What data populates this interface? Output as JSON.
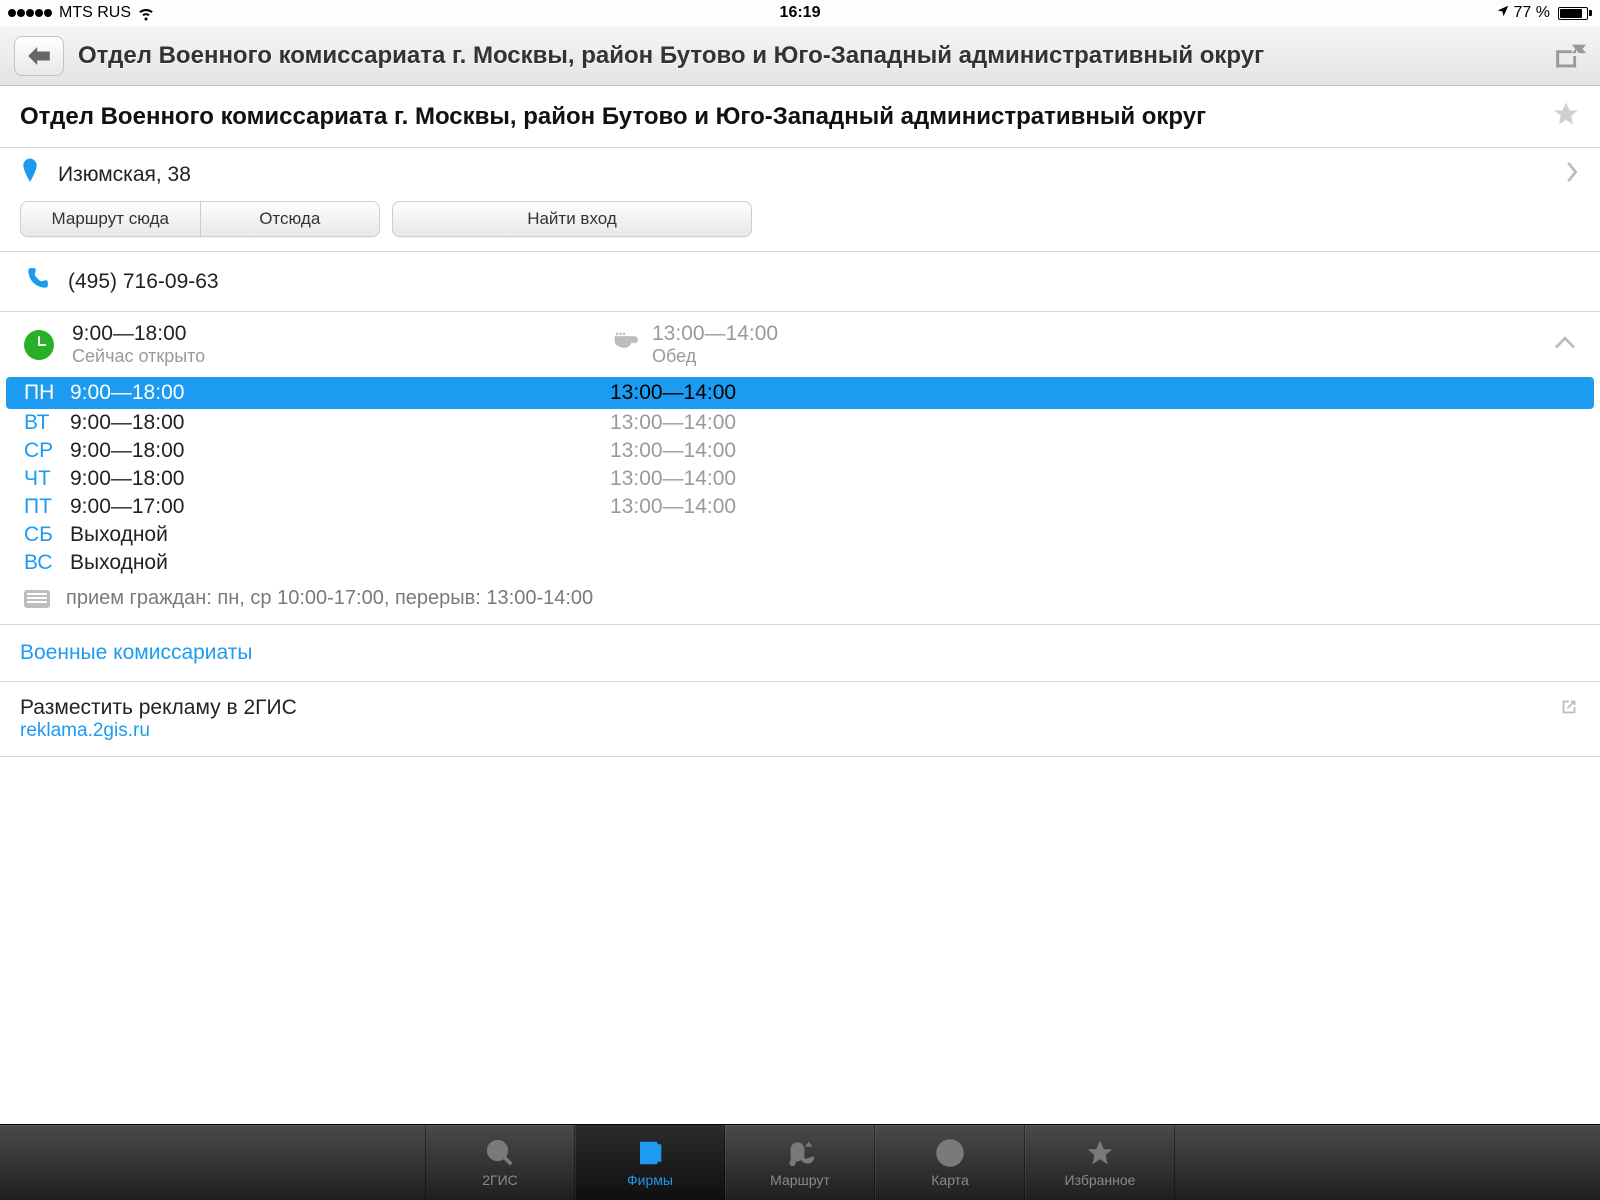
{
  "status": {
    "carrier": "MTS RUS",
    "time": "16:19",
    "battery_pct": "77 %"
  },
  "header": {
    "title": "Отдел Военного комиссариата г. Москвы, район Бутово и Юго-Западный административный округ"
  },
  "org": {
    "title": "Отдел Военного комиссариата г. Москвы, район Бутово и Юго-Западный административный округ",
    "address": "Изюмская, 38",
    "phone": "(495) 716-09-63"
  },
  "buttons": {
    "route_to": "Маршрут сюда",
    "from_here": "Отсюда",
    "find_entrance": "Найти вход"
  },
  "hours": {
    "range": "9:00—18:00",
    "status": "Сейчас открыто",
    "break_range": "13:00—14:00",
    "break_label": "Обед"
  },
  "schedule": [
    {
      "day": "ПН",
      "hours": "9:00—18:00",
      "break": "13:00—14:00",
      "today": true
    },
    {
      "day": "ВТ",
      "hours": "9:00—18:00",
      "break": "13:00—14:00",
      "today": false
    },
    {
      "day": "СР",
      "hours": "9:00—18:00",
      "break": "13:00—14:00",
      "today": false
    },
    {
      "day": "ЧТ",
      "hours": "9:00—18:00",
      "break": "13:00—14:00",
      "today": false
    },
    {
      "day": "ПТ",
      "hours": "9:00—17:00",
      "break": "13:00—14:00",
      "today": false
    },
    {
      "day": "СБ",
      "hours": "Выходной",
      "break": "",
      "today": false
    },
    {
      "day": "ВС",
      "hours": "Выходной",
      "break": "",
      "today": false
    }
  ],
  "note": "прием граждан: пн, ср 10:00-17:00, перерыв: 13:00-14:00",
  "category": "Военные комиссариаты",
  "ad": {
    "line1": "Разместить рекламу в 2ГИС",
    "line2": "reklama.2gis.ru"
  },
  "tabs": {
    "search": "2ГИС",
    "firms": "Фирмы",
    "route": "Маршрут",
    "map": "Карта",
    "fav": "Избранное"
  }
}
